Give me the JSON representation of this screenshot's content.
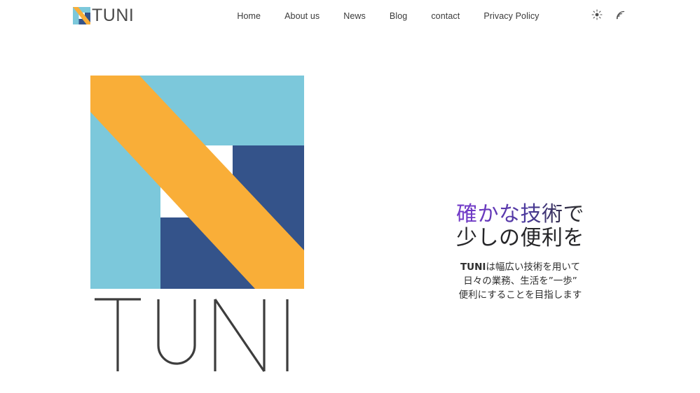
{
  "page": {
    "background_color": "#ffffff",
    "text_color": "#333333"
  },
  "header": {
    "brand": {
      "logo_icon_name": "tuni-logo-mark",
      "text": "TUNI"
    },
    "nav": [
      {
        "label": "Home"
      },
      {
        "label": "About us"
      },
      {
        "label": "News"
      },
      {
        "label": "Blog"
      },
      {
        "label": "contact"
      },
      {
        "label": "Privacy Policy"
      }
    ],
    "tools": [
      {
        "icon": "sun-icon",
        "label": ""
      },
      {
        "icon": "rss-icon",
        "label": ""
      }
    ]
  },
  "hero": {
    "visual": {
      "logo_icon_name": "tuni-n-mark",
      "wordmark_text": "TUNI",
      "colors": {
        "light_blue": "#7cc8db",
        "orange": "#f9ae38",
        "navy": "#34538a",
        "white": "#ffffff",
        "wordmark": "#3d3d3d"
      }
    },
    "title": {
      "line1": "確かな技術で",
      "line2": "少しの便利を",
      "accent_gradient_from": "#7b3fd1",
      "accent_gradient_to": "#26262a"
    },
    "description": {
      "line1_strong": "TUNI",
      "line1_rest": "は幅広い技術を用いて",
      "line2": "日々の業務、生活を”一歩”",
      "line3": "便利にすることを目指します"
    }
  }
}
